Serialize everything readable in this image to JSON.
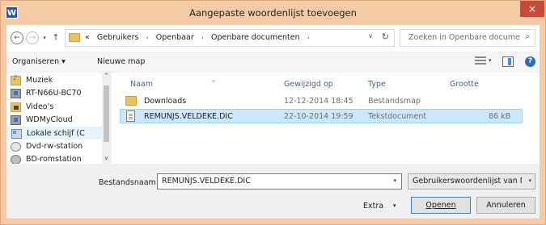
{
  "window": {
    "title": "Aangepaste woordenlijst toevoegen",
    "icon_letter": "W",
    "close_symbol": "×"
  },
  "navigation": {
    "back_symbol": "←",
    "forward_symbol": "→",
    "recent_symbol": "▾",
    "up_symbol": "↑",
    "breadcrumb_prefix": "«",
    "breadcrumbs": [
      "Gebruikers",
      "Openbaar",
      "Openbare documenten"
    ],
    "separator": "›",
    "refresh_symbol": "↻",
    "dropdown_symbol": "∨",
    "search_placeholder": "Zoeken in Openbare docume...",
    "search_symbol": "⌕"
  },
  "toolbar": {
    "organise": "Organiseren ▾",
    "new_folder": "Nieuwe map",
    "view_dropdown": "▾",
    "help": "?"
  },
  "nav_pane": {
    "items": [
      {
        "label": "Muziek",
        "icon": "music-folder-icon"
      },
      {
        "label": "RT-N66U-BC70",
        "icon": "network-device-icon"
      },
      {
        "label": "Video's",
        "icon": "video-folder-icon"
      },
      {
        "label": "WDMyCloud",
        "icon": "network-device-icon"
      },
      {
        "label": "Lokale schijf (C",
        "icon": "local-disk-icon",
        "selected": true
      },
      {
        "label": "Dvd-rw-station",
        "icon": "dvd-drive-icon"
      },
      {
        "label": "BD-romstation",
        "icon": "bd-drive-icon"
      }
    ],
    "scroll_up": "^",
    "scroll_down": "v"
  },
  "file_list": {
    "columns": [
      "Naam",
      "Gewijzigd op",
      "Type",
      "Grootte"
    ],
    "sort_indicator": "^",
    "rows": [
      {
        "name": "Downloads",
        "modified": "12-12-2014 18:45",
        "type": "Bestandsmap",
        "size": "",
        "selected": false
      },
      {
        "name": "REMUNJS.VELDEKE.DIC",
        "modified": "22-10-2014 19:59",
        "type": "Tekstdocument",
        "size": "86 kB",
        "selected": true
      }
    ]
  },
  "bottom": {
    "filename_label": "Bestandsnaam:",
    "filename_value": "REMUNJS.VELDEKE.DIC",
    "filetype_value": "Gebruikerswoordenlijst van Mic",
    "extra_label": "Extra",
    "extra_dropdown": "▾",
    "open_label": "Openen",
    "cancel_label": "Annuleren",
    "dropdown_symbol": "▾"
  }
}
